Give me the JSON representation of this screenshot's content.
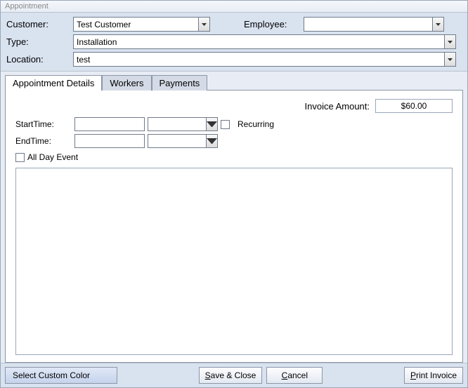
{
  "window": {
    "title": "Appointment"
  },
  "form": {
    "customer_label": "Customer:",
    "customer_value": "Test Customer",
    "employee_label": "Employee:",
    "employee_value": "",
    "type_label": "Type:",
    "type_value": "Installation",
    "location_label": "Location:",
    "location_value": "test"
  },
  "tabs": {
    "details": "Appointment Details",
    "workers": "Workers",
    "payments": "Payments"
  },
  "details": {
    "invoice_label": "Invoice Amount:",
    "invoice_value": "$60.00",
    "start_label": "StartTime:",
    "end_label": "EndTime:",
    "recurring_label": "Recurring",
    "allday_label": "All Day Event"
  },
  "footer": {
    "color": "Select Custom Color",
    "save_prefix": "S",
    "save_rest": "ave & Close",
    "cancel_prefix": "C",
    "cancel_rest": "ancel",
    "print_prefix": "P",
    "print_rest": "rint Invoice"
  }
}
